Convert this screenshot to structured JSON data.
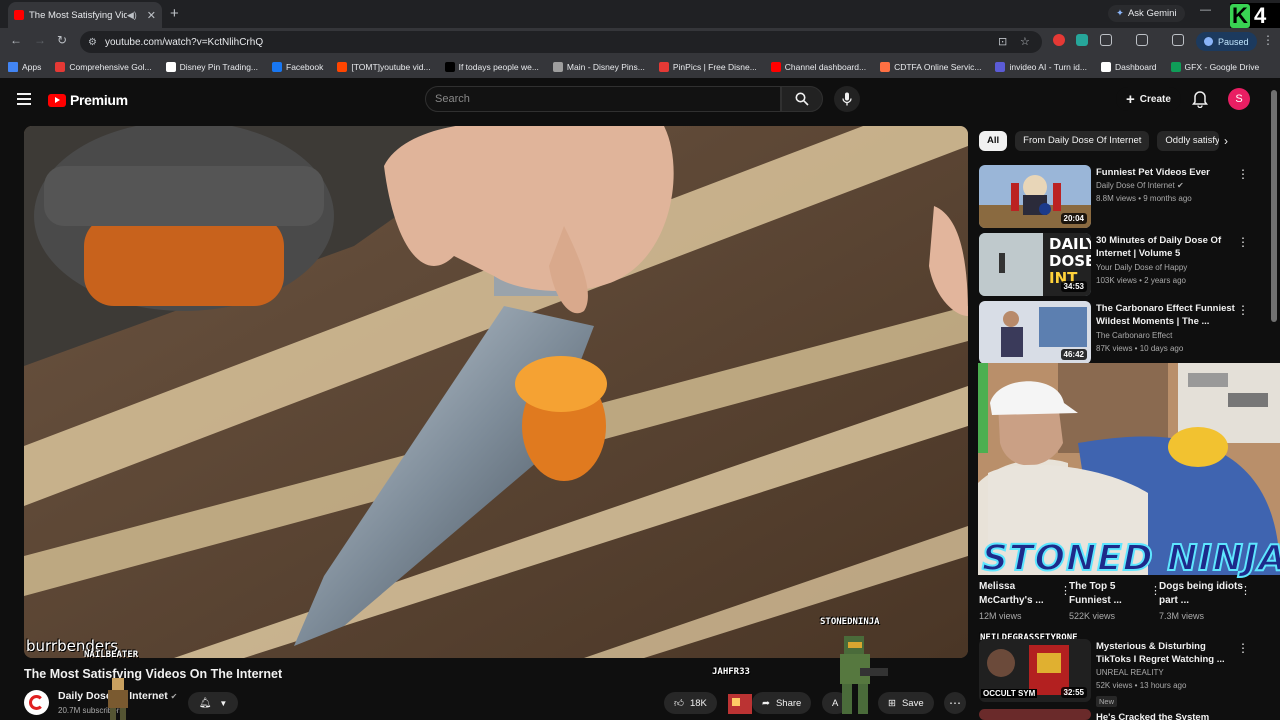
{
  "browser": {
    "tab_title": "The Most Satisfying Videos",
    "url": "youtube.com/watch?v=KctNlihCrhQ",
    "ask_gemini": "Ask Gemini",
    "paused": "Paused",
    "bookmarks": [
      "Apps",
      "Comprehensive Gol...",
      "Disney Pin Trading...",
      "Facebook",
      "[TOMT]youtube vid...",
      "If todays people we...",
      "Main - Disney Pins...",
      "PinPics | Free Disne...",
      "Channel dashboard...",
      "CDTFA Online Servic...",
      "invideo AI - Turn id...",
      "Dashboard",
      "GFX - Google Drive"
    ],
    "bookmark_colors": [
      "#4285f4",
      "#e53935",
      "#ffffff",
      "#1877f2",
      "#ff4500",
      "#000000",
      "#9e9e9e",
      "#e53935",
      "#ff0000",
      "#ff7043",
      "#5b5bd6",
      "#ffffff",
      "#0f9d58"
    ],
    "k_badge": "4"
  },
  "youtube": {
    "logo_text": "Premium",
    "search_placeholder": "Search",
    "create_label": "Create",
    "avatar_letter": "S"
  },
  "video": {
    "title": "The Most Satisfying Videos On The Internet",
    "channel": "Daily Dose Of Internet",
    "subscribers": "20.7M subscribers",
    "likes": "18K",
    "share_label": "Share",
    "save_label": "Save",
    "clip_pill": "A",
    "watermark": "burrbenders"
  },
  "overlay_names": {
    "nailbeater": "NAILBEATER",
    "jahfr": "JAHFR33",
    "stonedninja": "STONEDNINJA",
    "neil": "NEILDEGRASSETYRONE",
    "banner": "STONED NINJA"
  },
  "chips": [
    "All",
    "From Daily Dose Of Internet",
    "Oddly satisfy"
  ],
  "recommendations": [
    {
      "title": "Funniest Pet Videos Ever",
      "channel": "Daily Dose Of Internet",
      "meta": "8.8M views • 9 months ago",
      "duration": "20:04",
      "verified": true
    },
    {
      "title": "30 Minutes of Daily Dose Of Internet | Volume 5",
      "channel": "Your Daily Dose of Happy",
      "meta": "103K views • 2 years ago",
      "duration": "34:53"
    },
    {
      "title": "The Carbonaro Effect Funniest Wildest Moments | The ...",
      "channel": "The Carbonaro Effect",
      "meta": "87K views • 10 days ago",
      "duration": "46:42"
    },
    {
      "title": "Mysterious & Disturbing TikToks I Regret Watching ...",
      "channel": "UNREAL REALITY",
      "meta": "52K views • 13 hours ago",
      "duration": "32:55",
      "badge": "New"
    },
    {
      "title": "He's Cracked the System"
    }
  ],
  "thumb_texts": {
    "daily": "DAILY",
    "dose": "DOSE",
    "int": "INT",
    "occult": "OCCULT SYM"
  },
  "shorts": [
    {
      "title": "Melissa McCarthy's ...",
      "views": "12M views"
    },
    {
      "title": "The Top 5 Funniest ...",
      "views": "522K views"
    },
    {
      "title": "Dogs being idiots part ...",
      "views": "7.3M views"
    }
  ]
}
